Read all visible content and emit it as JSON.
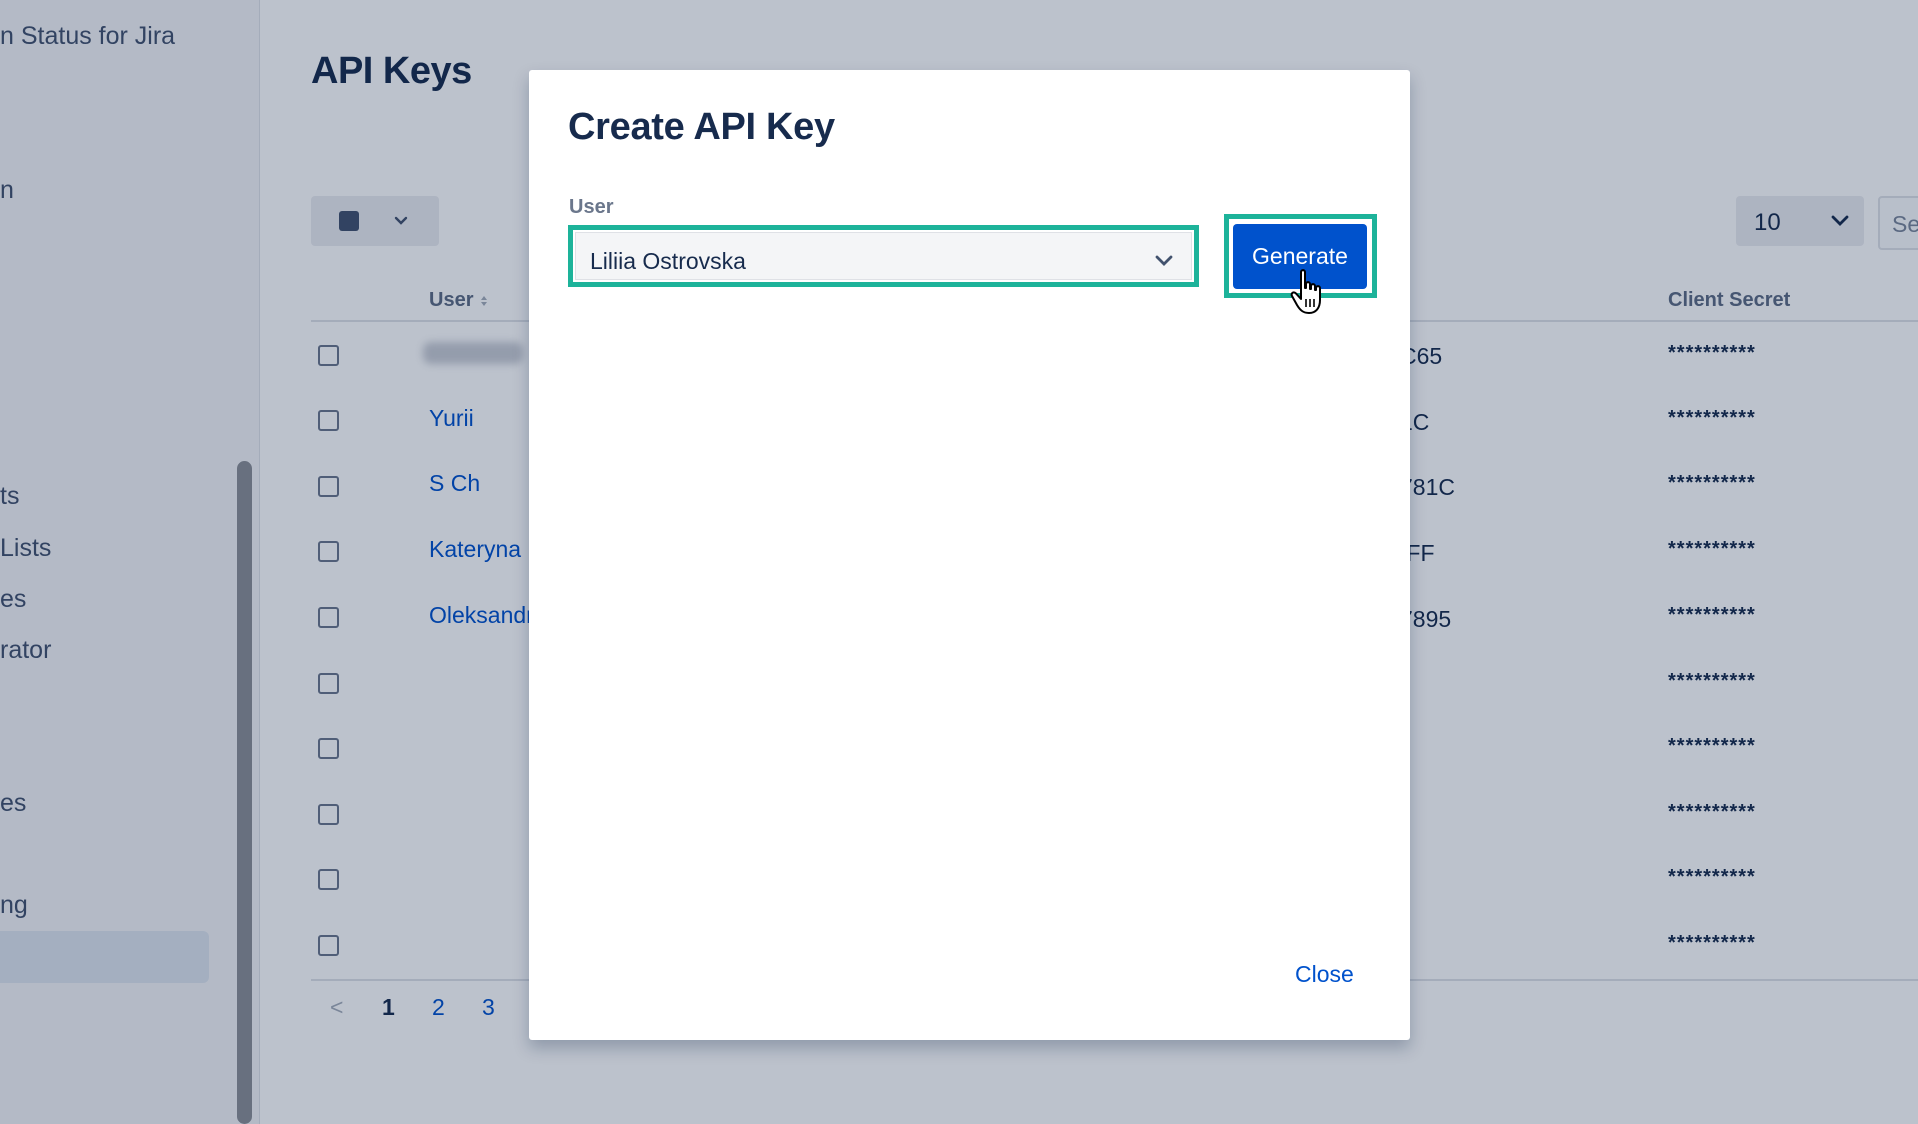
{
  "sidebar": {
    "items": [
      {
        "label": "n Status for Jira"
      },
      {
        "label": "n"
      },
      {
        "label": "ts"
      },
      {
        "label": " Lists"
      },
      {
        "label": "es"
      },
      {
        "label": "rator"
      },
      {
        "label": "es"
      },
      {
        "label": "ng"
      }
    ]
  },
  "page": {
    "title": "API Keys",
    "per_page": "10",
    "search_placeholder": "Se"
  },
  "table": {
    "headers": {
      "user": "User",
      "client_id": "",
      "client_secret": "Client Secret"
    },
    "rows": [
      {
        "user": "",
        "client_id": "C65",
        "client_secret": "**********"
      },
      {
        "user": "Yurii",
        "client_id": "1C",
        "client_secret": "**********"
      },
      {
        "user": "S Ch",
        "client_id": "781C",
        "client_secret": "**********"
      },
      {
        "user": "Kateryna",
        "client_id": "IFF",
        "client_secret": "**********"
      },
      {
        "user": "Oleksandr",
        "client_id": "7895",
        "client_secret": "**********"
      },
      {
        "user": "",
        "client_id": "",
        "client_secret": "**********"
      },
      {
        "user": "",
        "client_id": "",
        "client_secret": "**********"
      },
      {
        "user": "",
        "client_id": "",
        "client_secret": "**********"
      },
      {
        "user": "",
        "client_id": "",
        "client_secret": "**********"
      },
      {
        "user": "",
        "client_id": "",
        "client_secret": "**********"
      }
    ]
  },
  "pagination": {
    "prev": "<",
    "pages": [
      "1",
      "2",
      "3"
    ],
    "current": "1"
  },
  "modal": {
    "title": "Create API Key",
    "user_label": "User",
    "selected_user": "Liliia Ostrovska",
    "generate_label": "Generate",
    "close_label": "Close"
  },
  "colors": {
    "primary": "#0052cc",
    "highlight": "#1db39a",
    "text": "#172b4d",
    "overlay": "rgba(9,30,66,0.27)"
  },
  "icons": [
    "chevron-down-icon",
    "sort-icon",
    "hand-cursor-icon"
  ]
}
